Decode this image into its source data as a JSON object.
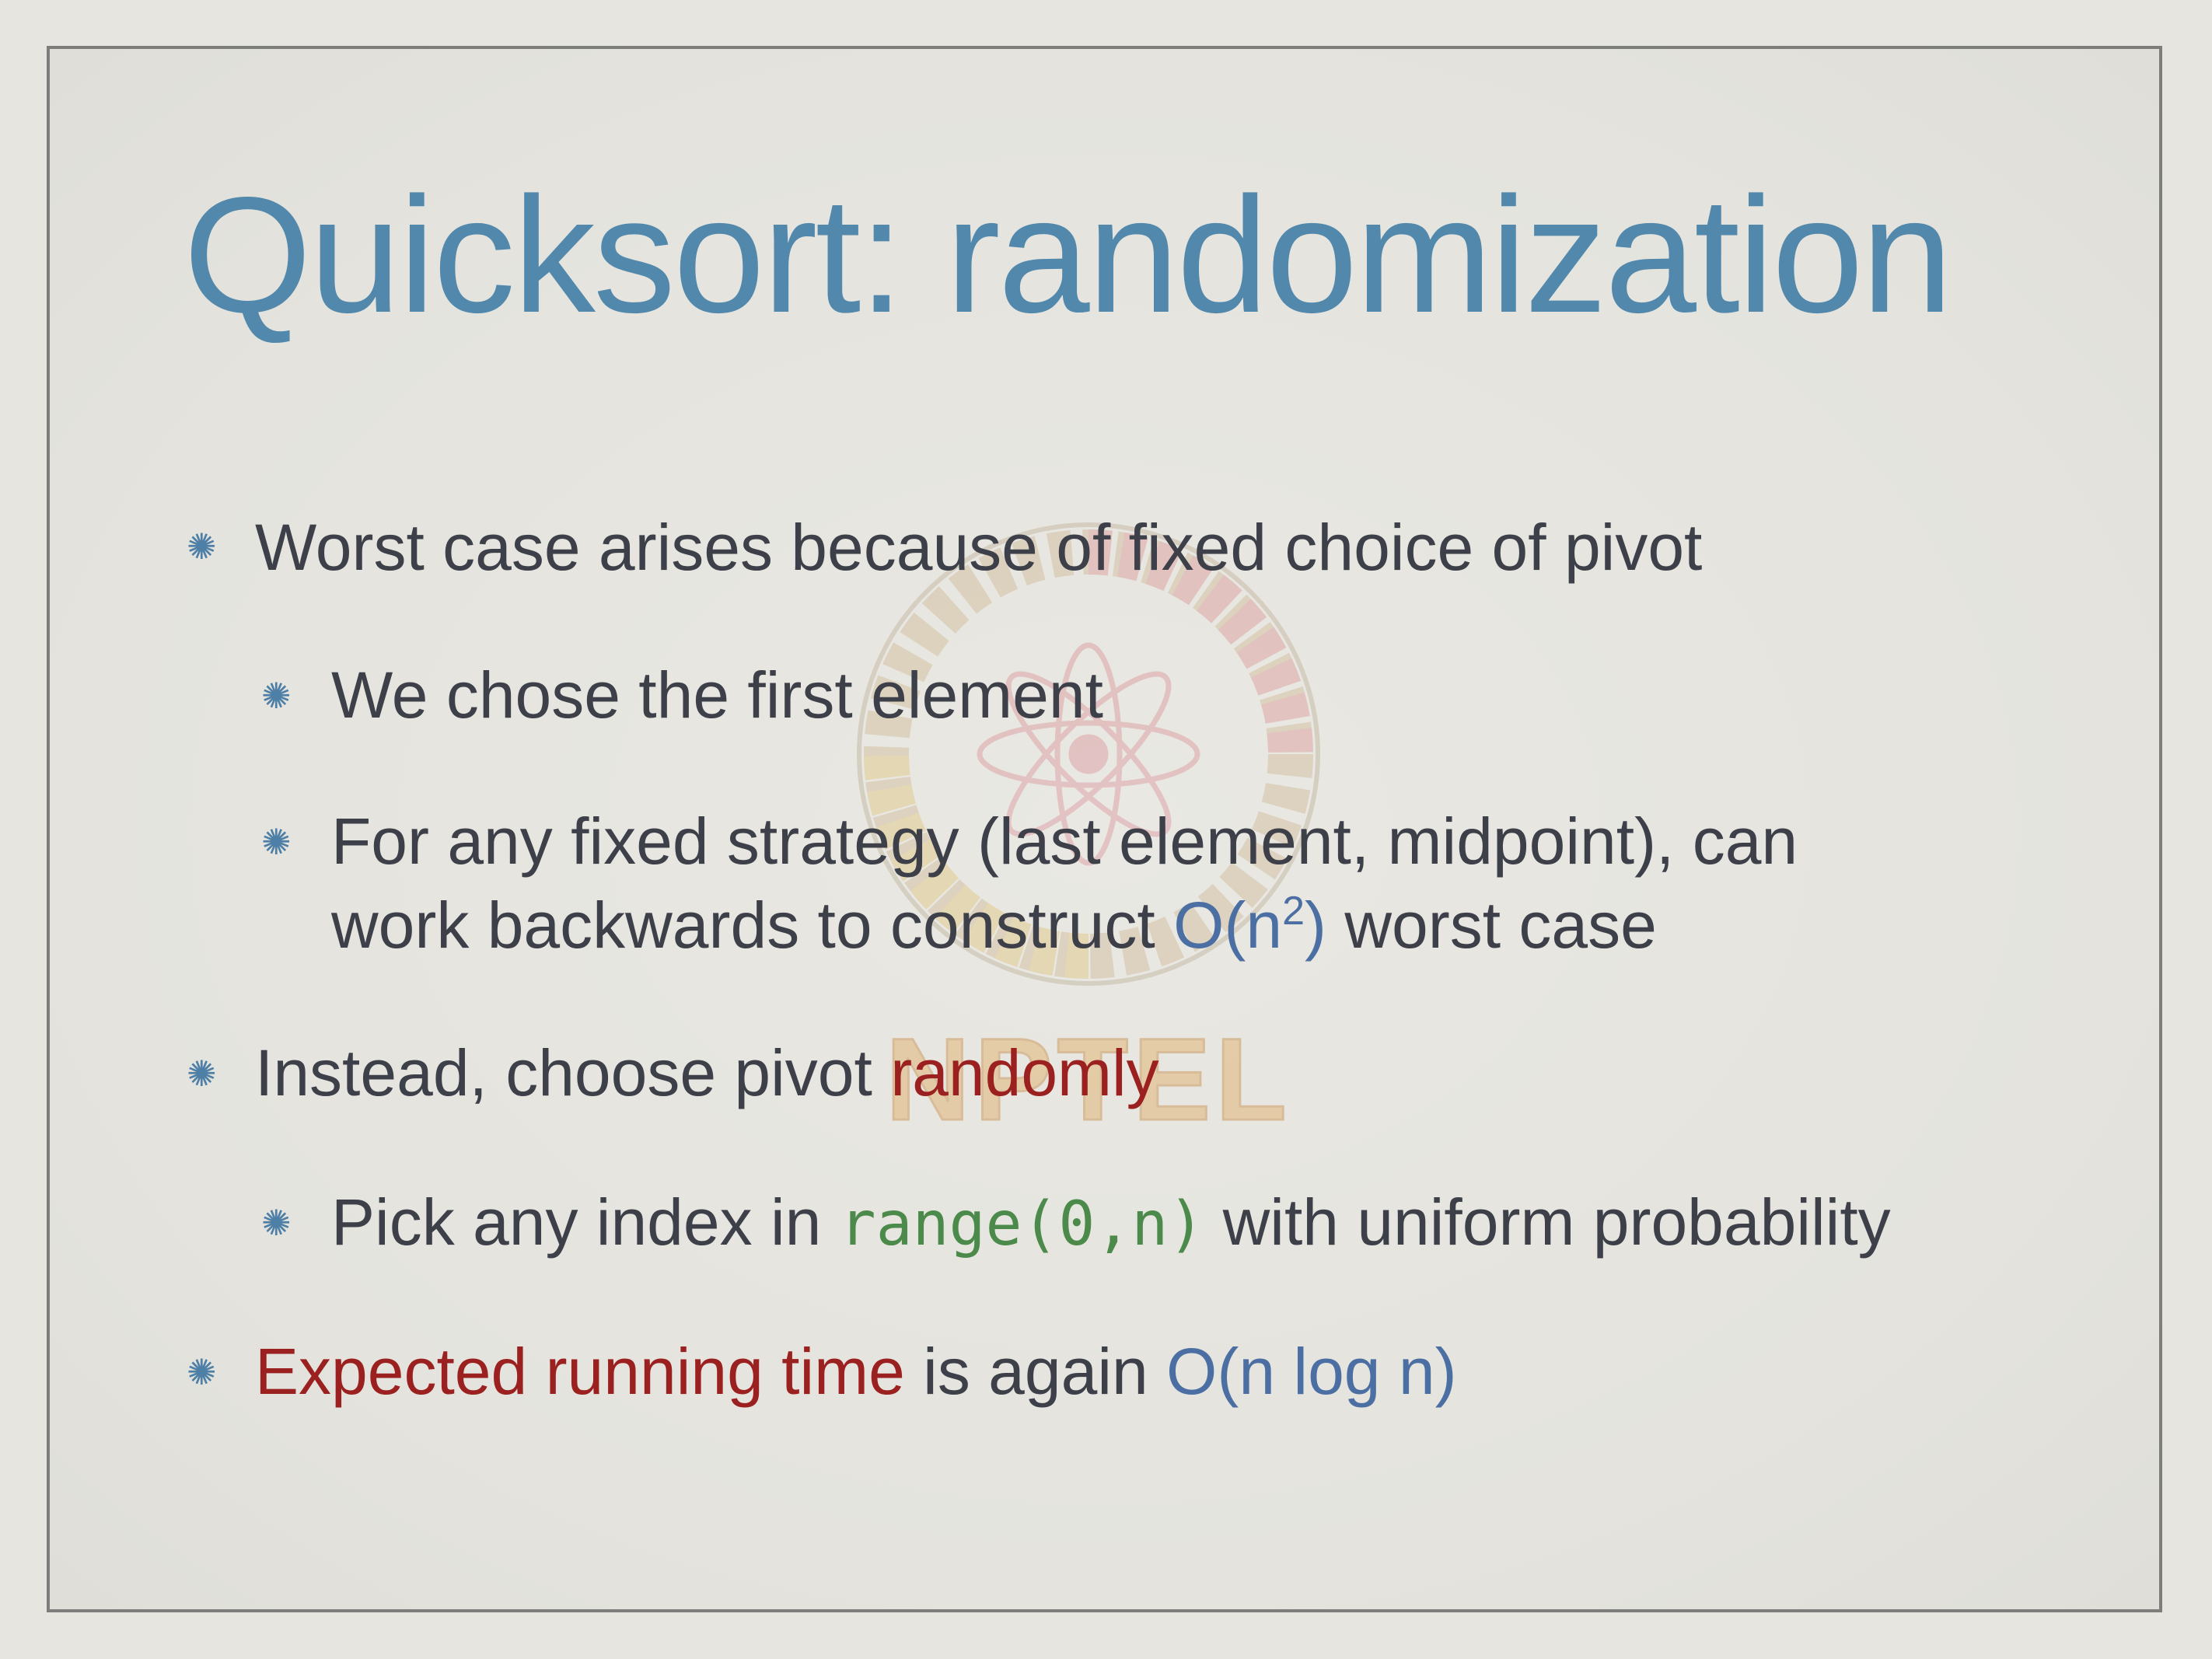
{
  "slide": {
    "title": "Quicksort: randomization",
    "bullets": [
      {
        "level": 1,
        "text": "Worst case arises because of fixed choice of pivot"
      },
      {
        "level": 2,
        "text": "We chose the first element"
      },
      {
        "level": 2,
        "line1": "For any fixed strategy (last element, midpoint), can",
        "line2_pre": "work backwards to construct ",
        "line2_math": "O(n",
        "line2_sup": "2",
        "line2_math_close": ")",
        "line2_post": " worst case"
      },
      {
        "level": 1,
        "pre": "Instead, choose pivot ",
        "highlight": "randomly"
      },
      {
        "level": 2,
        "pre": "Pick any index in ",
        "code": "range(0,n)",
        "post": " with uniform probability"
      },
      {
        "level": 1,
        "highlight": "Expected running time",
        "mid": " is again ",
        "math": "O(n log n)"
      }
    ],
    "watermark_text": "NPTEL"
  },
  "colors": {
    "title": "#5188ac",
    "body_text": "#3d4049",
    "math_blue": "#4c6fa3",
    "emphasis_red": "#9b2020",
    "code_green": "#4b8a4b",
    "bullet_star": "#4e7fa6",
    "background": "#e6e5df",
    "frame_border": "#7d7d7b"
  },
  "icons": {
    "bullet": "asterisk-bullet-icon",
    "watermark": "nptel-logo"
  }
}
